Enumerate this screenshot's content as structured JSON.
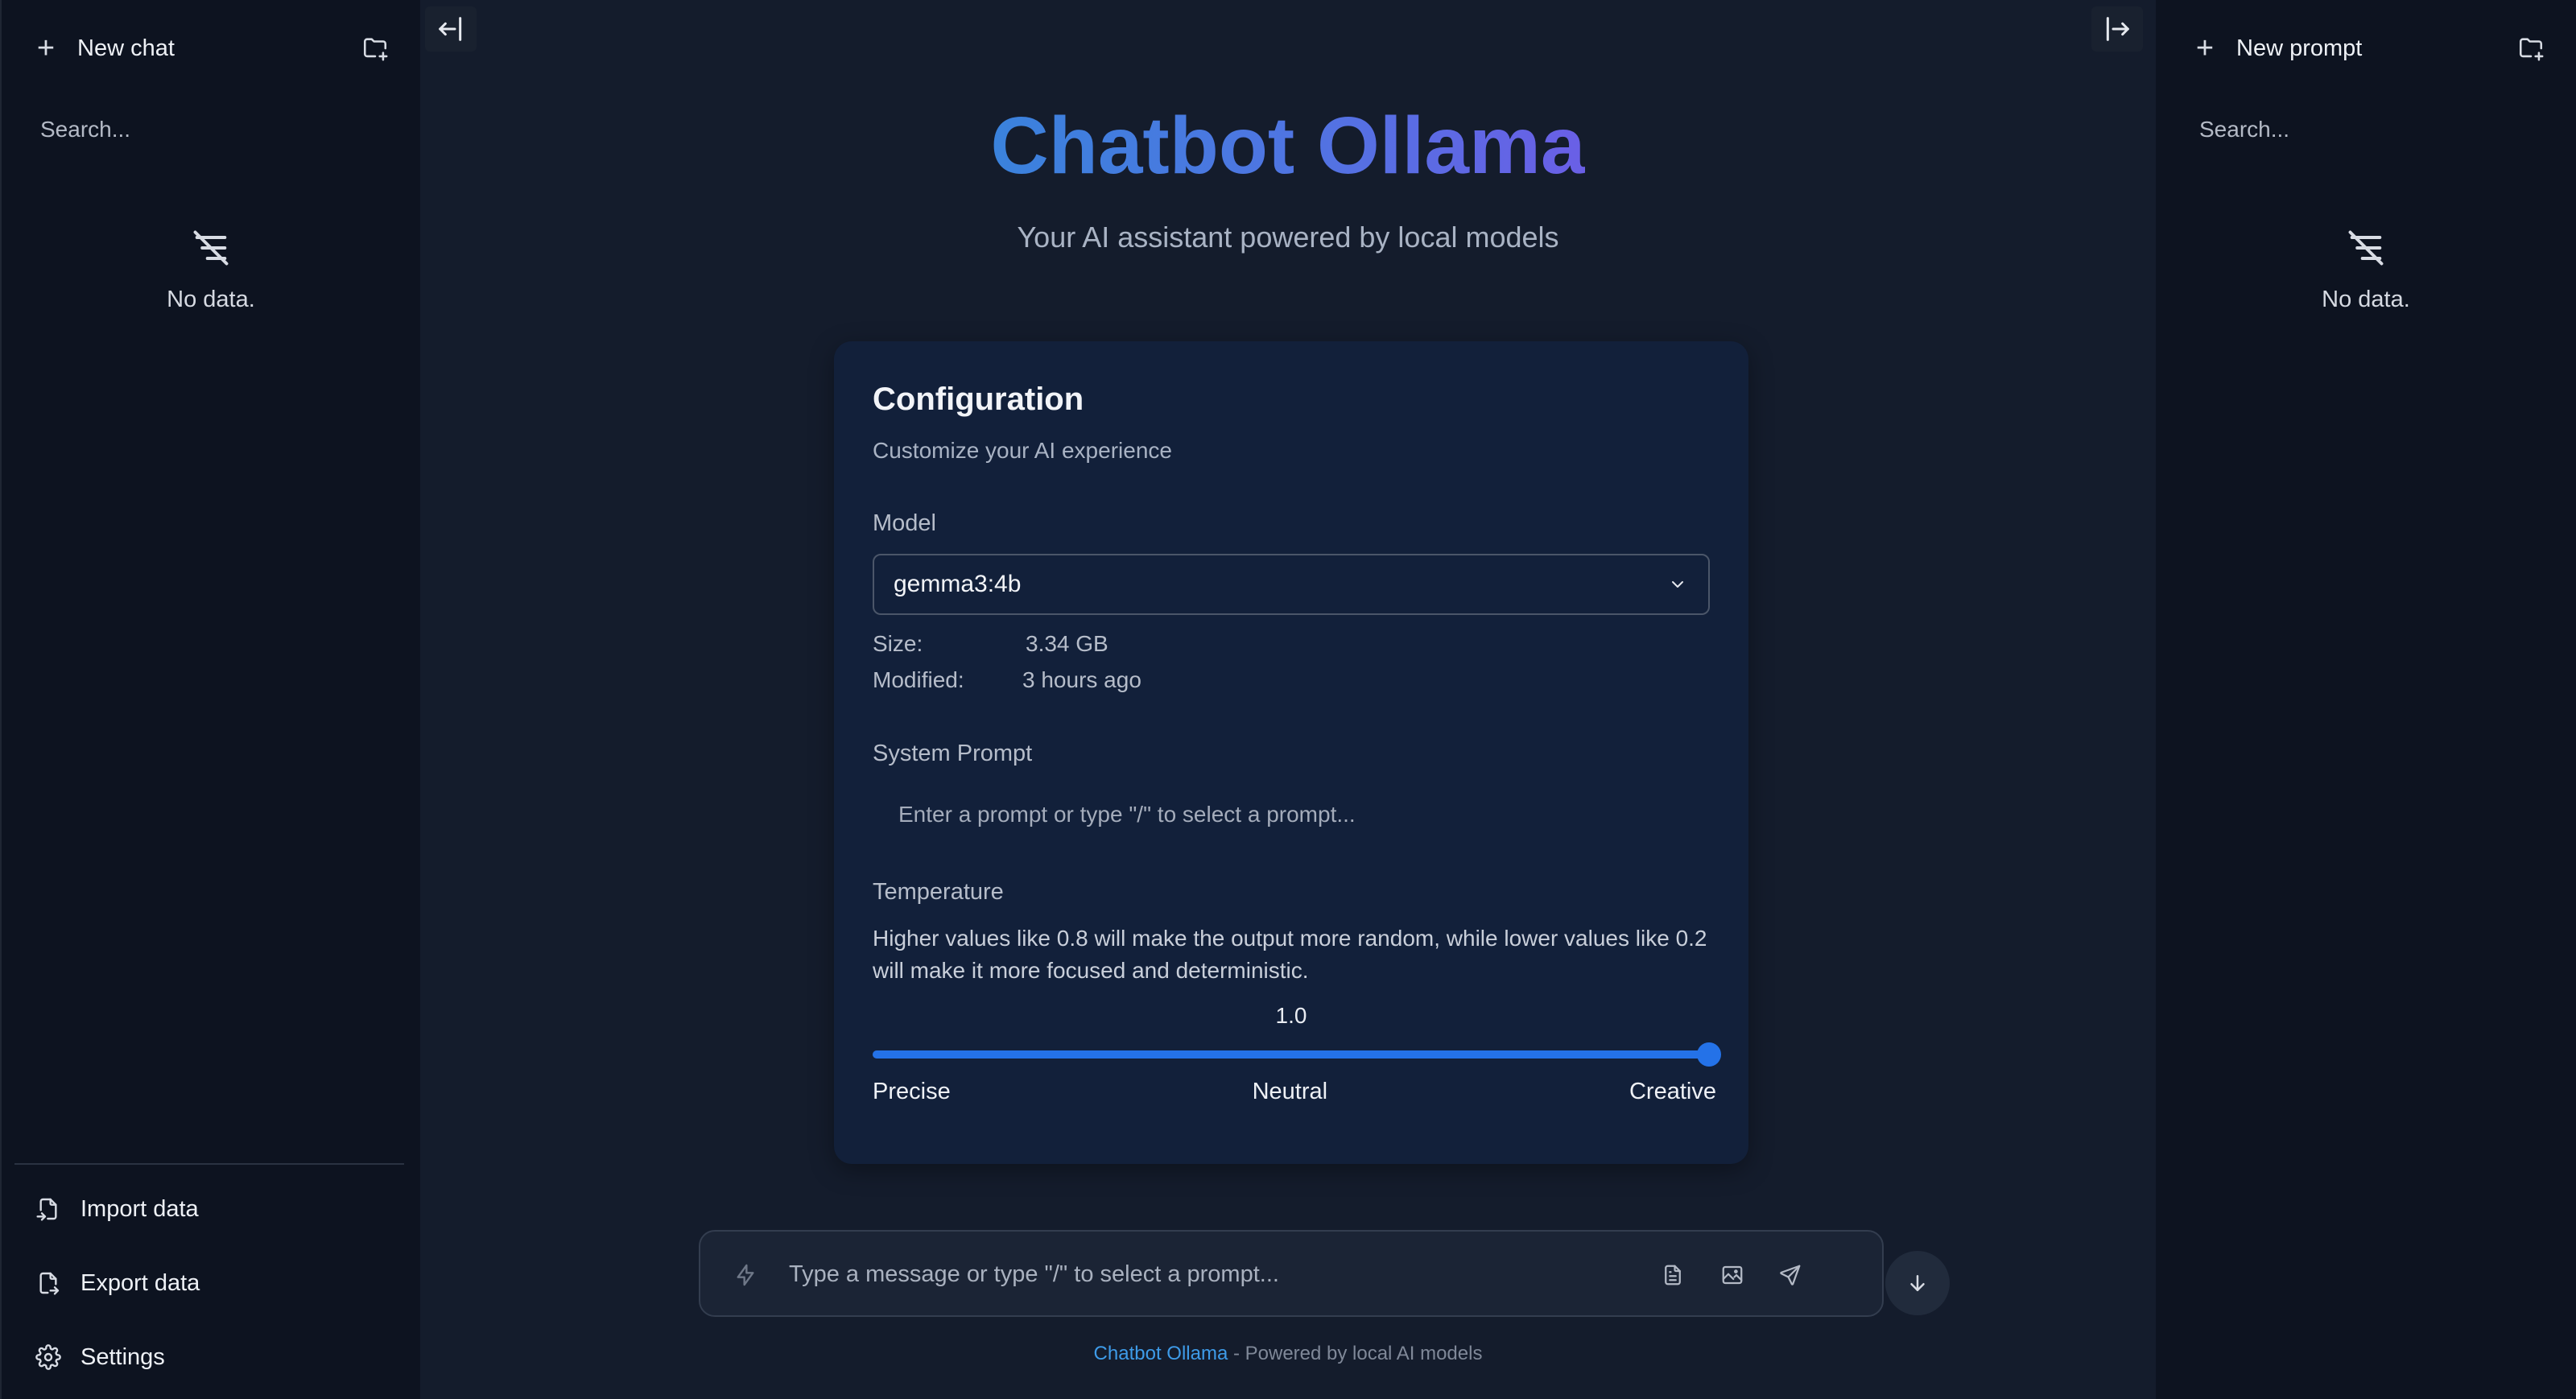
{
  "left_sidebar": {
    "new_chat_label": "New chat",
    "search_placeholder": "Search...",
    "empty_text": "No data.",
    "actions": {
      "import_label": "Import data",
      "export_label": "Export data",
      "settings_label": "Settings"
    }
  },
  "right_sidebar": {
    "new_prompt_label": "New prompt",
    "search_placeholder": "Search...",
    "empty_text": "No data."
  },
  "main": {
    "title": "Chatbot Ollama",
    "subtitle": "Your AI assistant powered by local models"
  },
  "config": {
    "title": "Configuration",
    "subtitle": "Customize your AI experience",
    "model_label": "Model",
    "model_value": "gemma3:4b",
    "size_label": "Size:",
    "size_value": "3.34 GB",
    "modified_label": "Modified:",
    "modified_value": "3 hours ago",
    "system_prompt_label": "System Prompt",
    "system_prompt_placeholder": "Enter a prompt or type \"/\" to select a prompt...",
    "temperature_label": "Temperature",
    "temperature_description": "Higher values like 0.8 will make the output more random, while lower values like 0.2 will make it more focused and deterministic.",
    "temperature_value": "1.0",
    "temperature_fraction": 1.0,
    "slider_labels": {
      "low": "Precise",
      "mid": "Neutral",
      "high": "Creative"
    }
  },
  "composer": {
    "placeholder": "Type a message or type \"/\" to select a prompt..."
  },
  "footer": {
    "brand": "Chatbot Ollama",
    "tagline": " - Powered by local AI models"
  },
  "icons": {
    "new_folder": "folder-plus-icon",
    "empty": "filter-off-icon",
    "collapse_left": "arrow-left-to-bar-icon",
    "collapse_right": "arrow-right-from-bar-icon",
    "import": "file-import-icon",
    "export": "file-export-icon",
    "settings": "gear-icon",
    "bolt": "bolt-icon",
    "document": "document-icon",
    "image": "image-icon",
    "send": "send-icon",
    "scroll_down": "arrow-down-icon"
  },
  "colors": {
    "accent": "#2472e8",
    "title_gradient_start": "#3a82dc",
    "title_gradient_end": "#6a5fe6",
    "background": "#141c2c",
    "sidebar": "#0d1320",
    "card": "#12203a"
  }
}
